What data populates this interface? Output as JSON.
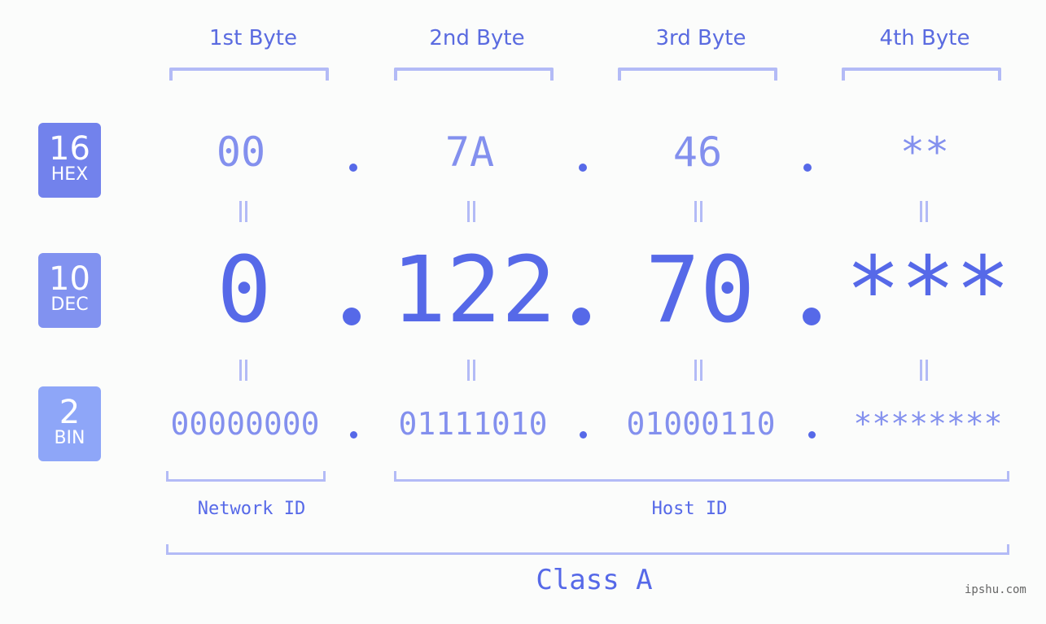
{
  "headers": [
    "1st Byte",
    "2nd Byte",
    "3rd Byte",
    "4th Byte"
  ],
  "bases": [
    {
      "num": "16",
      "label": "HEX",
      "color": "#7282ec"
    },
    {
      "num": "10",
      "label": "DEC",
      "color": "#8192f0"
    },
    {
      "num": "2",
      "label": "BIN",
      "color": "#8ea6f8"
    }
  ],
  "hex": [
    "00",
    "7A",
    "46",
    "**"
  ],
  "dec": [
    "0",
    "122",
    "70",
    "***"
  ],
  "bin": [
    "00000000",
    "01111010",
    "01000110",
    "********"
  ],
  "separator": ".",
  "network_label": "Network ID",
  "host_label": "Host ID",
  "class_label": "Class A",
  "watermark": "ipshu.com"
}
